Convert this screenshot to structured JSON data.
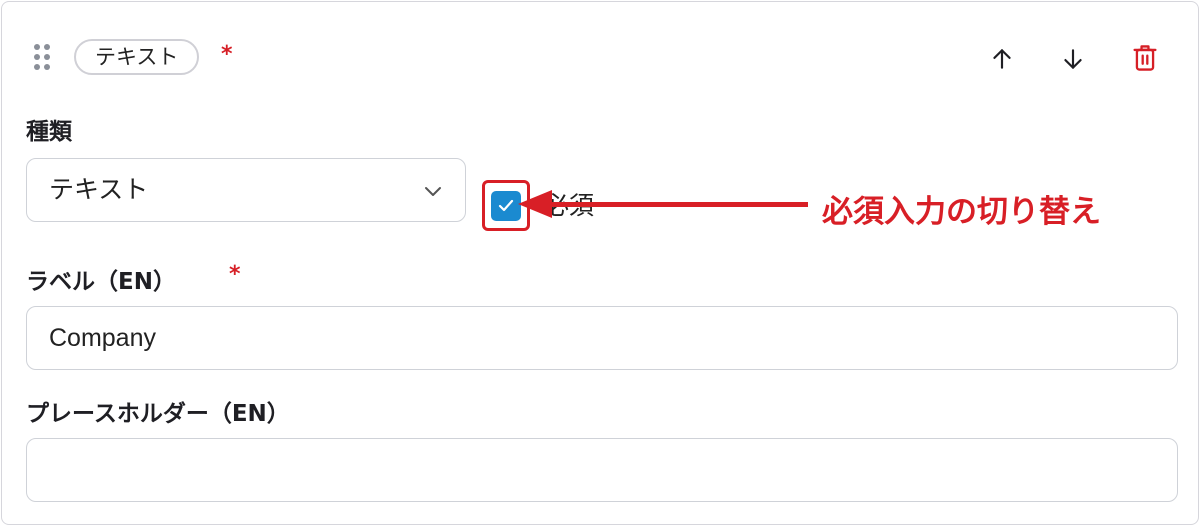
{
  "field_header": {
    "type_badge": "テキスト",
    "required_marker": "*"
  },
  "type_field": {
    "label": "種類",
    "selected_value": "テキスト"
  },
  "required_checkbox": {
    "label": "必須",
    "checked": true
  },
  "annotation": {
    "text": "必須入力の切り替え",
    "color": "#d81f26"
  },
  "label_field": {
    "label": "ラベル（EN）",
    "required_marker": "*",
    "value": "Company"
  },
  "placeholder_field": {
    "label": "プレースホルダー（EN）",
    "value": ""
  },
  "icons": [
    "drag-handle-icon",
    "arrow-up-icon",
    "arrow-down-icon",
    "trash-icon",
    "chevron-down-icon",
    "check-icon"
  ],
  "colors": {
    "accent": "#1b8ad0",
    "danger": "#d61f26",
    "border": "#cfd2d8"
  }
}
